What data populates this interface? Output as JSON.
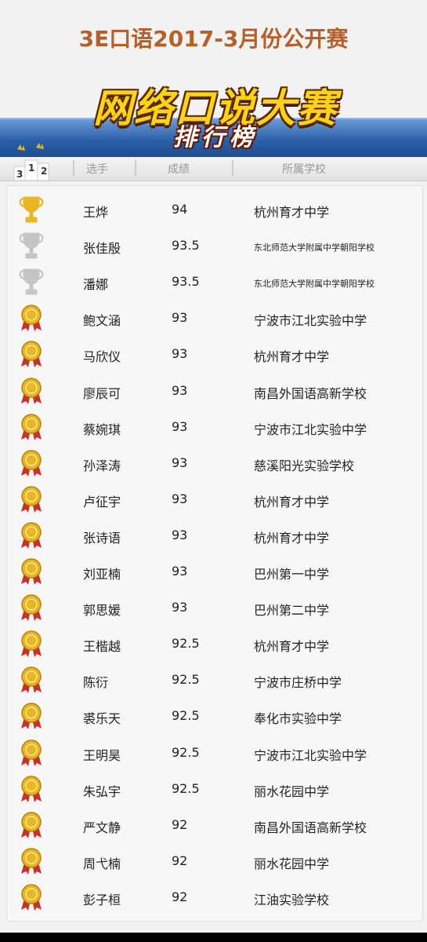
{
  "page": {
    "title": "3E口语2017-3月份公开赛",
    "banner_main": "网络口说大赛",
    "banner_sub": "排行榜"
  },
  "header": {
    "podium_numbers": [
      "3",
      "1",
      "2"
    ],
    "col_player": "选手",
    "col_score": "成绩",
    "col_school": "所属学校"
  },
  "colors": {
    "gold": "#e8b624",
    "silver": "#c5c5c5",
    "medal_ribbon": "#c8302c",
    "banner_blue": "#2a5fa8",
    "title": "#b5602a"
  },
  "rows": [
    {
      "icon": "gold-trophy-icon",
      "name": "王烨",
      "score": "94",
      "school": "杭州育才中学"
    },
    {
      "icon": "silver-trophy-icon",
      "name": "张佳殷",
      "score": "93.5",
      "school": "东北师范大学附属中学朝阳学校"
    },
    {
      "icon": "silver-trophy-icon",
      "name": "潘娜",
      "score": "93.5",
      "school": "东北师范大学附属中学朝阳学校"
    },
    {
      "icon": "medal-icon",
      "name": "鲍文涵",
      "score": "93",
      "school": "宁波市江北实验中学"
    },
    {
      "icon": "medal-icon",
      "name": "马欣仪",
      "score": "93",
      "school": "杭州育才中学"
    },
    {
      "icon": "medal-icon",
      "name": "廖辰可",
      "score": "93",
      "school": "南昌外国语高新学校"
    },
    {
      "icon": "medal-icon",
      "name": "蔡婉琪",
      "score": "93",
      "school": "宁波市江北实验中学"
    },
    {
      "icon": "medal-icon",
      "name": "孙泽涛",
      "score": "93",
      "school": "慈溪阳光实验学校"
    },
    {
      "icon": "medal-icon",
      "name": "卢征宇",
      "score": "93",
      "school": "杭州育才中学"
    },
    {
      "icon": "medal-icon",
      "name": "张诗语",
      "score": "93",
      "school": "杭州育才中学"
    },
    {
      "icon": "medal-icon",
      "name": "刘亚楠",
      "score": "93",
      "school": "巴州第一中学"
    },
    {
      "icon": "medal-icon",
      "name": "郭思媛",
      "score": "93",
      "school": "巴州第二中学"
    },
    {
      "icon": "medal-icon",
      "name": "王楷越",
      "score": "92.5",
      "school": "杭州育才中学"
    },
    {
      "icon": "medal-icon",
      "name": "陈衍",
      "score": "92.5",
      "school": "宁波市庄桥中学"
    },
    {
      "icon": "medal-icon",
      "name": "裘乐天",
      "score": "92.5",
      "school": "奉化市实验中学"
    },
    {
      "icon": "medal-icon",
      "name": "王明昊",
      "score": "92.5",
      "school": "宁波市江北实验中学"
    },
    {
      "icon": "medal-icon",
      "name": "朱弘宇",
      "score": "92.5",
      "school": "丽水花园中学"
    },
    {
      "icon": "medal-icon",
      "name": "严文静",
      "score": "92",
      "school": "南昌外国语高新学校"
    },
    {
      "icon": "medal-icon",
      "name": "周弋楠",
      "score": "92",
      "school": "丽水花园中学"
    },
    {
      "icon": "medal-icon",
      "name": "彭子桓",
      "score": "92",
      "school": "江油实验学校"
    }
  ]
}
